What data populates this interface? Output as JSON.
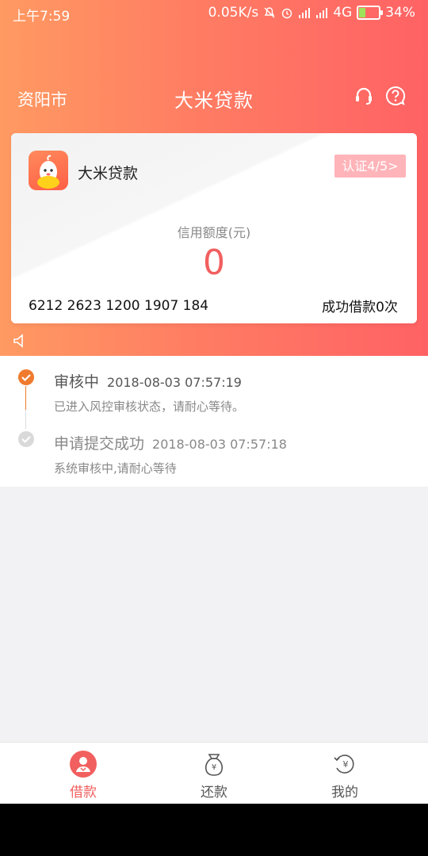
{
  "status_bar": {
    "time": "上午7:59",
    "network_speed": "0.05K/s",
    "network_type": "4G",
    "battery": "34%",
    "battery_level": 0.34
  },
  "nav": {
    "city": "资阳市",
    "title": "大米贷款"
  },
  "card": {
    "brand": "大米贷款",
    "certification": "认证4/5",
    "credit_label": "信用额度(元)",
    "credit_value": "0",
    "card_number": "6212 2623 1200 1907 184",
    "success_loans": "成功借款0次"
  },
  "timeline": [
    {
      "title": "审核中",
      "time": "2018-08-03 07:57:19",
      "desc": "已进入风控审核状态，请耐心等待。",
      "active": true
    },
    {
      "title": "申请提交成功",
      "time": "2018-08-03 07:57:18",
      "desc": "系统审核中,请耐心等待",
      "active": false
    }
  ],
  "tabs": [
    {
      "label": "借款",
      "icon": "borrow-icon",
      "active": true
    },
    {
      "label": "还款",
      "icon": "repay-icon",
      "active": false
    },
    {
      "label": "我的",
      "icon": "my-account-icon",
      "active": false
    }
  ],
  "colors": {
    "accent": "#f25f5f",
    "orange": "#f07a2e",
    "inactive": "#555555"
  }
}
